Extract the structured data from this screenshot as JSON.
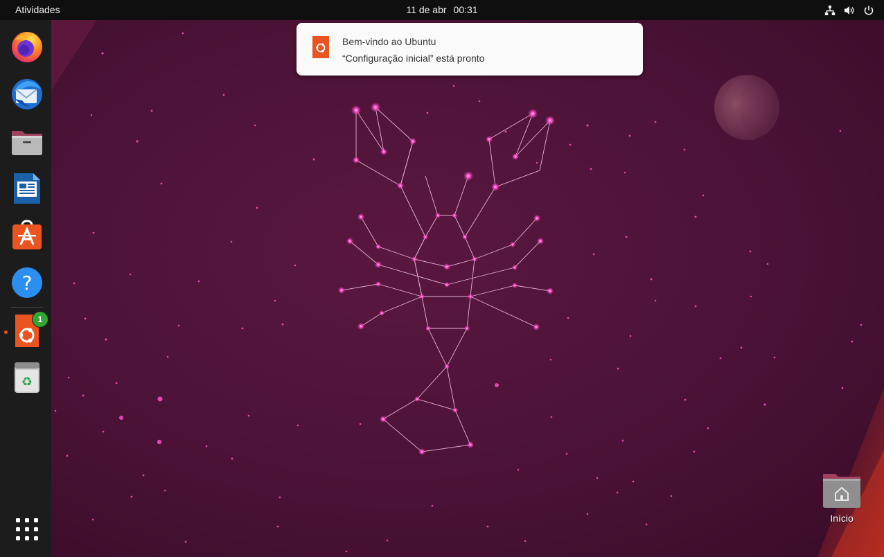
{
  "topbar": {
    "activities_label": "Atividades",
    "date": "11 de abr",
    "time": "00:31",
    "tray_icons": [
      "network-icon",
      "volume-icon",
      "power-icon"
    ]
  },
  "dock": {
    "apps": [
      {
        "name": "firefox-icon"
      },
      {
        "name": "thunderbird-icon"
      },
      {
        "name": "files-icon"
      },
      {
        "name": "libreoffice-writer-icon"
      },
      {
        "name": "app-center-icon"
      },
      {
        "name": "help-icon"
      },
      {
        "name": "ubuntu-welcome-icon",
        "badge": "1",
        "running": true
      },
      {
        "name": "trash-icon"
      }
    ],
    "show_apps_icon": "app-grid-icon"
  },
  "notification": {
    "title": "Bem-vindo ao Ubuntu",
    "body": "“Configuração inicial” está pronto",
    "icon": "ubuntu-logo-icon"
  },
  "desktop": {
    "home_label": "Início"
  },
  "colors": {
    "accent": "#e95420",
    "topbar": "#0f0f0f",
    "dock": "#1c1c1c",
    "badge": "#33a532"
  }
}
